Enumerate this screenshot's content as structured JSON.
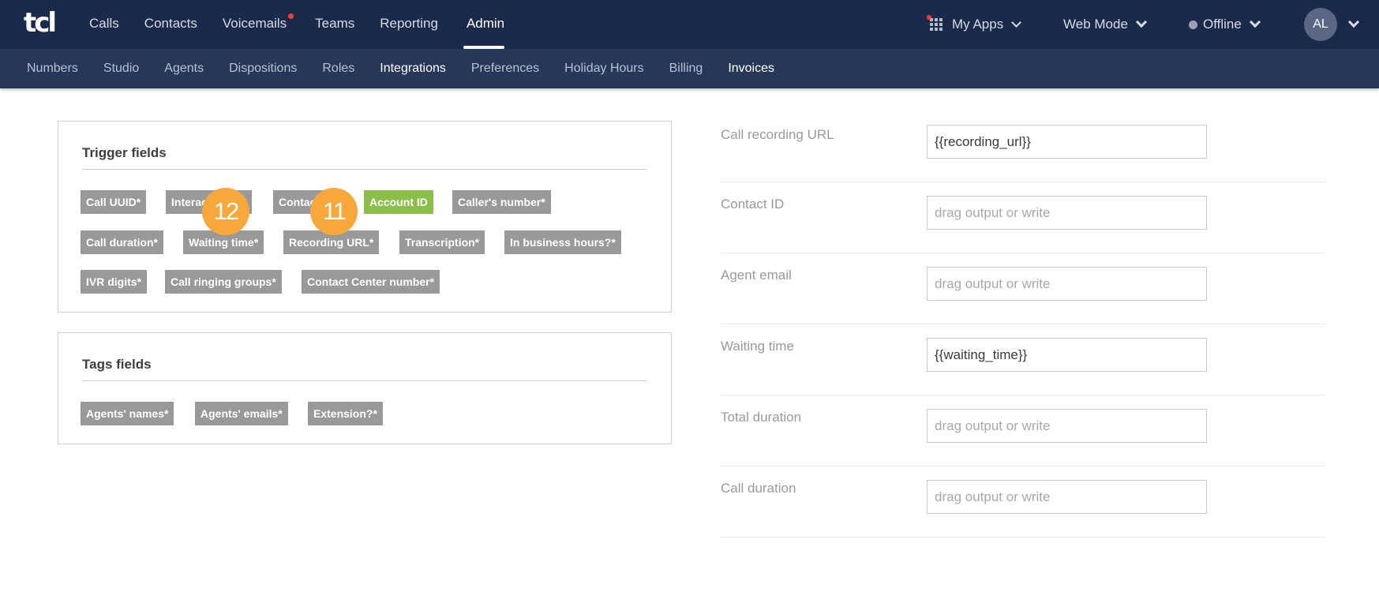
{
  "header": {
    "logo_text": "tcl",
    "nav": [
      {
        "label": "Calls"
      },
      {
        "label": "Contacts"
      },
      {
        "label": "Voicemails"
      },
      {
        "label": "Teams"
      },
      {
        "label": "Reporting"
      },
      {
        "label": "Admin"
      }
    ],
    "my_apps_label": "My Apps",
    "web_mode_label": "Web Mode",
    "status_label": "Offline",
    "avatar_initials": "AL"
  },
  "subnav": [
    {
      "label": "Numbers"
    },
    {
      "label": "Studio"
    },
    {
      "label": "Agents"
    },
    {
      "label": "Dispositions"
    },
    {
      "label": "Roles"
    },
    {
      "label": "Integrations"
    },
    {
      "label": "Preferences"
    },
    {
      "label": "Holiday Hours"
    },
    {
      "label": "Billing"
    },
    {
      "label": "Invoices"
    }
  ],
  "trigger_card": {
    "title": "Trigger fields",
    "chips": [
      {
        "label": "Call UUID*"
      },
      {
        "label": "Interaction ID*"
      },
      {
        "label": "Contact ID*"
      },
      {
        "label": "Account ID"
      },
      {
        "label": "Caller's number*"
      },
      {
        "label": "Call duration*"
      },
      {
        "label": "Waiting time*"
      },
      {
        "label": "Recording URL*"
      },
      {
        "label": "Transcription*"
      },
      {
        "label": "In business hours?*"
      },
      {
        "label": "IVR digits*"
      },
      {
        "label": "Call ringing groups*"
      },
      {
        "label": "Contact Center number*"
      }
    ]
  },
  "tags_card": {
    "title": "Tags fields",
    "chips": [
      {
        "label": "Agents' names*"
      },
      {
        "label": "Agents' emails*"
      },
      {
        "label": "Extension?*"
      }
    ]
  },
  "badges": [
    {
      "label": "12"
    },
    {
      "label": "11"
    }
  ],
  "form": {
    "rows": [
      {
        "label": "Call recording URL",
        "value": "{{recording_url}}",
        "placeholder": "drag output or write"
      },
      {
        "label": "Contact ID",
        "value": "",
        "placeholder": "drag output or write"
      },
      {
        "label": "Agent email",
        "value": "",
        "placeholder": "drag output or write"
      },
      {
        "label": "Waiting time",
        "value": "{{waiting_time}}",
        "placeholder": "drag output or write"
      },
      {
        "label": "Total duration",
        "value": "",
        "placeholder": "drag output or write"
      },
      {
        "label": "Call duration",
        "value": "",
        "placeholder": "drag output or write"
      }
    ]
  },
  "colors": {
    "topbar": "#1b2a4a",
    "subbar": "#27375a",
    "chip": "#999999",
    "chip_active": "#8bbf4a",
    "badge": "#f7a83d"
  }
}
